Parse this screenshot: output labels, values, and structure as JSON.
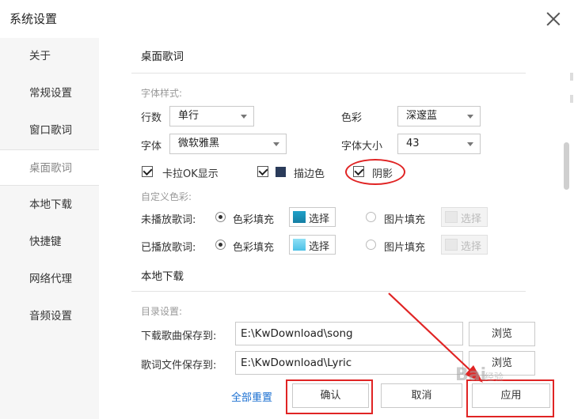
{
  "window": {
    "title": "系统设置"
  },
  "sidebar": {
    "items": [
      {
        "label": "关于"
      },
      {
        "label": "常规设置"
      },
      {
        "label": "窗口歌词"
      },
      {
        "label": "桌面歌词"
      },
      {
        "label": "本地下载"
      },
      {
        "label": "快捷键"
      },
      {
        "label": "网络代理"
      },
      {
        "label": "音频设置"
      }
    ],
    "active_label": "桌面歌词"
  },
  "desktop_lyrics": {
    "heading": "桌面歌词",
    "font_style_label": "字体样式:",
    "rows_label": "行数",
    "rows_value": "单行",
    "color_label": "色彩",
    "color_value": "深邃蓝",
    "font_label": "字体",
    "font_value": "微软雅黑",
    "font_size_label": "字体大小",
    "font_size_value": "43",
    "karaoke_label": "卡拉OK显示",
    "karaoke_checked": true,
    "stroke_label": "描边色",
    "stroke_checked": true,
    "shadow_label": "阴影",
    "shadow_checked": true,
    "custom_color_label": "自定义色彩:",
    "unplayed_label": "未播放歌词:",
    "played_label": "已播放歌词:",
    "color_fill_label": "色彩填充",
    "image_fill_label": "图片填充",
    "choose_label": "选择"
  },
  "local_download": {
    "heading": "本地下载",
    "dir_label": "目录设置:",
    "song_dir_label": "下载歌曲保存到:",
    "song_dir_value": "E:\\KwDownload\\song",
    "lyric_dir_label": "歌词文件保存到:",
    "lyric_dir_value": "E:\\KwDownload\\Lyric",
    "browse_label": "浏览"
  },
  "footer": {
    "reset_all": "全部重置",
    "confirm": "确认",
    "cancel": "取消",
    "apply": "应用"
  },
  "watermark": {
    "text": "Bai",
    "sub": "经验"
  },
  "colors": {
    "annotation_red": "#e02424",
    "link_blue": "#1a6fd1",
    "stroke_swatch": "#2a3b5a",
    "unplayed_chip": "#1fa0c8",
    "played_chip": "#6fd0ee"
  }
}
